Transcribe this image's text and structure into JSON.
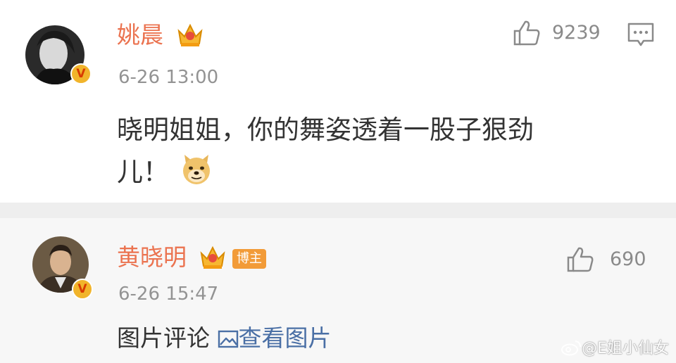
{
  "comments": [
    {
      "name": "姚晨",
      "time": "6-26 13:00",
      "likes": "9239",
      "text_line1": "晓明姐姐，你的舞姿透着一股子狠劲",
      "text_line2": "儿！",
      "verified_badge": "V"
    },
    {
      "name": "黄晓明",
      "tag": "博主",
      "time": "6-26 15:47",
      "likes": "690",
      "text_prefix": "图片评论",
      "link_text": "查看图片",
      "verified_badge": "V"
    }
  ],
  "watermark": "@E姐小仙女",
  "colors": {
    "name": "#eb7350",
    "link": "#4a6fa5",
    "badge": "#f1b42b",
    "tag": "#f29b38"
  },
  "icons": [
    "crown-icon",
    "thumbs-up-icon",
    "reply-comment-icon",
    "doge-emoji-icon",
    "image-icon",
    "weibo-logo-icon"
  ]
}
